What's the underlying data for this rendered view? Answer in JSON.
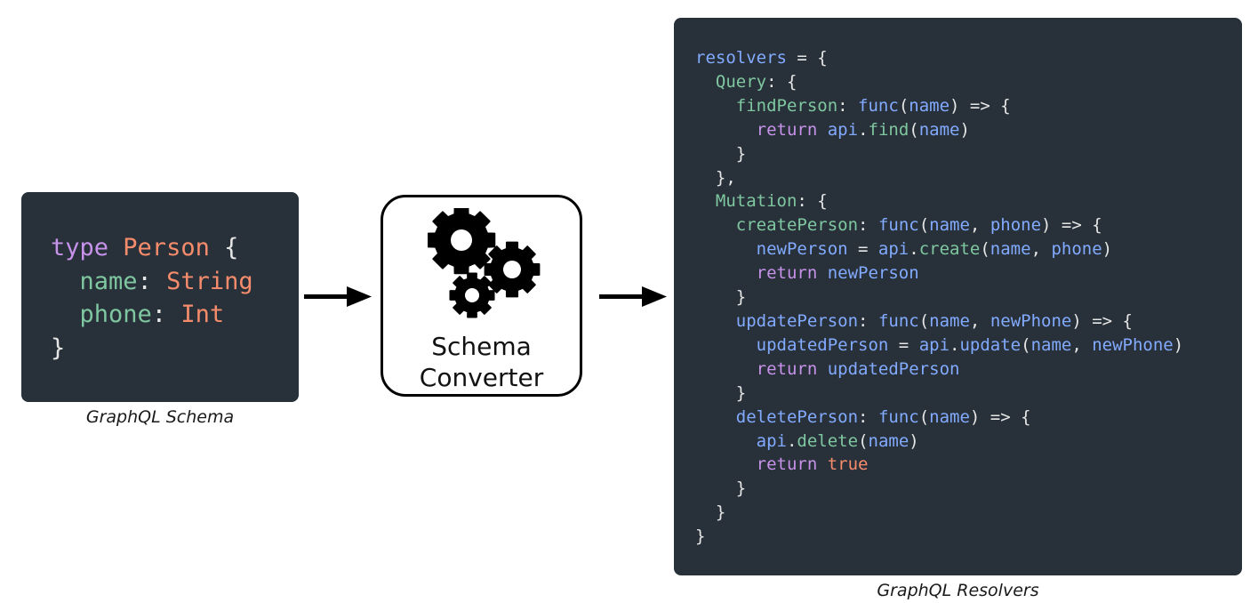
{
  "schema": {
    "caption": "GraphQL Schema",
    "lines": [
      [
        {
          "t": "type",
          "c": "kw"
        },
        {
          "t": " ",
          "c": "pu"
        },
        {
          "t": "Person",
          "c": "ty"
        },
        {
          "t": " {",
          "c": "pu"
        }
      ],
      [
        {
          "t": "  ",
          "c": "pu"
        },
        {
          "t": "name",
          "c": "pr"
        },
        {
          "t": ": ",
          "c": "pu"
        },
        {
          "t": "String",
          "c": "ty"
        }
      ],
      [
        {
          "t": "  ",
          "c": "pu"
        },
        {
          "t": "phone",
          "c": "pr"
        },
        {
          "t": ": ",
          "c": "pu"
        },
        {
          "t": "Int",
          "c": "ty"
        }
      ],
      [
        {
          "t": "}",
          "c": "pu"
        }
      ]
    ]
  },
  "converter": {
    "label_line1": "Schema",
    "label_line2": "Converter",
    "icon": "gears-icon"
  },
  "resolvers": {
    "caption": "GraphQL Resolvers",
    "lines": [
      [
        {
          "t": "resolvers",
          "c": "fn"
        },
        {
          "t": " = {",
          "c": "pu"
        }
      ],
      [
        {
          "t": "  ",
          "c": "pu"
        },
        {
          "t": "Query",
          "c": "pr"
        },
        {
          "t": ": {",
          "c": "pu"
        }
      ],
      [
        {
          "t": "    ",
          "c": "pu"
        },
        {
          "t": "findPerson",
          "c": "pr"
        },
        {
          "t": ": ",
          "c": "pu"
        },
        {
          "t": "func",
          "c": "fn"
        },
        {
          "t": "(",
          "c": "pu"
        },
        {
          "t": "name",
          "c": "fn"
        },
        {
          "t": ") => {",
          "c": "pu"
        }
      ],
      [
        {
          "t": "      ",
          "c": "pu"
        },
        {
          "t": "return",
          "c": "kw"
        },
        {
          "t": " ",
          "c": "pu"
        },
        {
          "t": "api",
          "c": "fn"
        },
        {
          "t": ".",
          "c": "pu"
        },
        {
          "t": "find",
          "c": "pr"
        },
        {
          "t": "(",
          "c": "pu"
        },
        {
          "t": "name",
          "c": "fn"
        },
        {
          "t": ")",
          "c": "pu"
        }
      ],
      [
        {
          "t": "    }",
          "c": "pu"
        }
      ],
      [
        {
          "t": "  },",
          "c": "pu"
        }
      ],
      [
        {
          "t": "  ",
          "c": "pu"
        },
        {
          "t": "Mutation",
          "c": "pr"
        },
        {
          "t": ": {",
          "c": "pu"
        }
      ],
      [
        {
          "t": "    ",
          "c": "pu"
        },
        {
          "t": "createPerson",
          "c": "pr"
        },
        {
          "t": ": ",
          "c": "pu"
        },
        {
          "t": "func",
          "c": "fn"
        },
        {
          "t": "(",
          "c": "pu"
        },
        {
          "t": "name",
          "c": "fn"
        },
        {
          "t": ", ",
          "c": "pu"
        },
        {
          "t": "phone",
          "c": "fn"
        },
        {
          "t": ") => {",
          "c": "pu"
        }
      ],
      [
        {
          "t": "      ",
          "c": "pu"
        },
        {
          "t": "newPerson",
          "c": "fn"
        },
        {
          "t": " = ",
          "c": "pu"
        },
        {
          "t": "api",
          "c": "fn"
        },
        {
          "t": ".",
          "c": "pu"
        },
        {
          "t": "create",
          "c": "pr"
        },
        {
          "t": "(",
          "c": "pu"
        },
        {
          "t": "name",
          "c": "fn"
        },
        {
          "t": ", ",
          "c": "pu"
        },
        {
          "t": "phone",
          "c": "fn"
        },
        {
          "t": ")",
          "c": "pu"
        }
      ],
      [
        {
          "t": "      ",
          "c": "pu"
        },
        {
          "t": "return",
          "c": "kw"
        },
        {
          "t": " ",
          "c": "pu"
        },
        {
          "t": "newPerson",
          "c": "fn"
        }
      ],
      [
        {
          "t": "    }",
          "c": "pu"
        }
      ],
      [
        {
          "t": "    ",
          "c": "pu"
        },
        {
          "t": "updatePerson",
          "c": "fn"
        },
        {
          "t": ": ",
          "c": "pu"
        },
        {
          "t": "func",
          "c": "fn"
        },
        {
          "t": "(",
          "c": "pu"
        },
        {
          "t": "name",
          "c": "fn"
        },
        {
          "t": ", ",
          "c": "pu"
        },
        {
          "t": "newPhone",
          "c": "fn"
        },
        {
          "t": ") => {",
          "c": "pu"
        }
      ],
      [
        {
          "t": "      ",
          "c": "pu"
        },
        {
          "t": "updatedPerson",
          "c": "fn"
        },
        {
          "t": " = ",
          "c": "pu"
        },
        {
          "t": "api",
          "c": "fn"
        },
        {
          "t": ".",
          "c": "pu"
        },
        {
          "t": "update",
          "c": "fn"
        },
        {
          "t": "(",
          "c": "pu"
        },
        {
          "t": "name",
          "c": "fn"
        },
        {
          "t": ", ",
          "c": "pu"
        },
        {
          "t": "newPhone",
          "c": "fn"
        },
        {
          "t": ")",
          "c": "pu"
        }
      ],
      [
        {
          "t": "      ",
          "c": "pu"
        },
        {
          "t": "return",
          "c": "kw"
        },
        {
          "t": " ",
          "c": "pu"
        },
        {
          "t": "updatedPerson",
          "c": "fn"
        }
      ],
      [
        {
          "t": "    }",
          "c": "pu"
        }
      ],
      [
        {
          "t": "    ",
          "c": "pu"
        },
        {
          "t": "deletePerson",
          "c": "fn"
        },
        {
          "t": ": ",
          "c": "pu"
        },
        {
          "t": "func",
          "c": "fn"
        },
        {
          "t": "(",
          "c": "pu"
        },
        {
          "t": "name",
          "c": "fn"
        },
        {
          "t": ") => {",
          "c": "pu"
        }
      ],
      [
        {
          "t": "      ",
          "c": "pu"
        },
        {
          "t": "api",
          "c": "fn"
        },
        {
          "t": ".",
          "c": "pu"
        },
        {
          "t": "delete",
          "c": "pr"
        },
        {
          "t": "(",
          "c": "pu"
        },
        {
          "t": "name",
          "c": "fn"
        },
        {
          "t": ")",
          "c": "pu"
        }
      ],
      [
        {
          "t": "      ",
          "c": "pu"
        },
        {
          "t": "return",
          "c": "kw"
        },
        {
          "t": " ",
          "c": "pu"
        },
        {
          "t": "true",
          "c": "ty"
        }
      ],
      [
        {
          "t": "    }",
          "c": "pu"
        }
      ],
      [
        {
          "t": "  }",
          "c": "pu"
        }
      ],
      [
        {
          "t": "}",
          "c": "pu"
        }
      ]
    ]
  },
  "colors": {
    "panel_bg": "#283139",
    "keyword": "#c792ea",
    "type": "#f78c6c",
    "property": "#7fc7a0",
    "identifier": "#82aaff",
    "punctuation": "#e6e6e6"
  }
}
